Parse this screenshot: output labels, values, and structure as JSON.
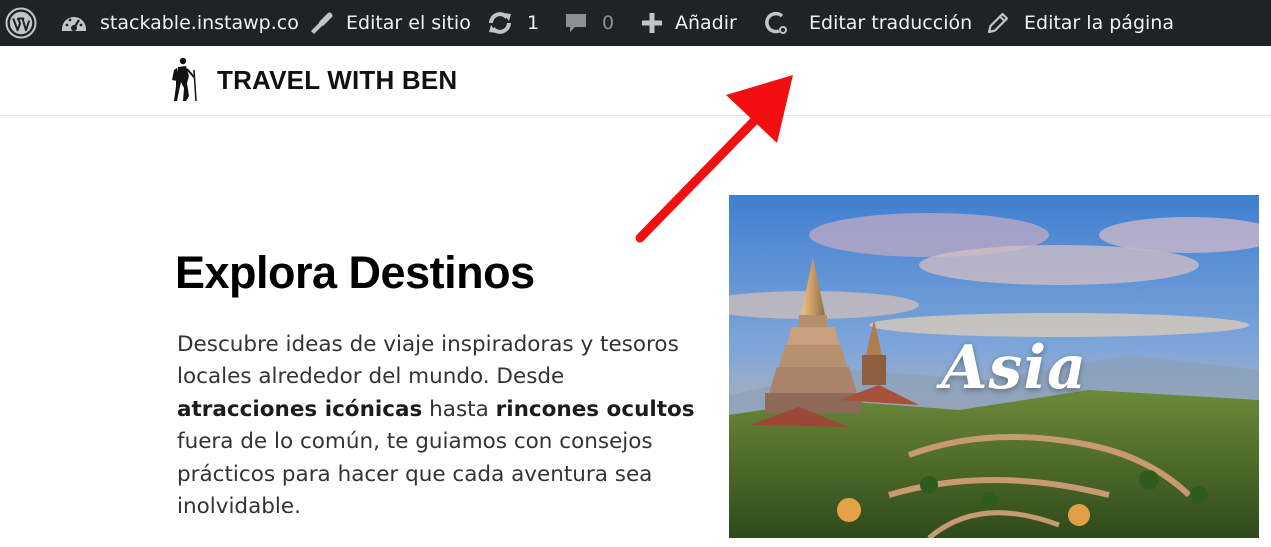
{
  "adminbar": {
    "site": "stackable.instawp.co",
    "customize": "Editar el sitio",
    "updates_count": "1",
    "comments_count": "0",
    "new": "Añadir",
    "translate": "Editar traducción",
    "edit_page": "Editar la página"
  },
  "header": {
    "site_title": "TRAVEL WITH BEN"
  },
  "hero": {
    "title": "Explora Destinos",
    "text_1": "Descubre ideas de viaje inspiradoras y tesoros locales alrededor del mundo. Desde ",
    "bold_1": "atracciones icónicas",
    "text_2": " hasta ",
    "bold_2": "rincones ocultos",
    "text_3": " fuera de lo común, te guiamos con consejos prácticos para hacer que cada aventura sea inolvidable."
  },
  "card": {
    "label": "Asia"
  },
  "colors": {
    "adminbar_bg": "#1d2327",
    "adminbar_text": "#f0f0f1",
    "annotation_arrow": "#f20f0f"
  },
  "icons": [
    "wordpress-icon",
    "dashboard-icon",
    "customize-brush-icon",
    "updates-icon",
    "comment-icon",
    "plus-icon",
    "translate-icon",
    "pencil-icon",
    "hiker-logo"
  ]
}
